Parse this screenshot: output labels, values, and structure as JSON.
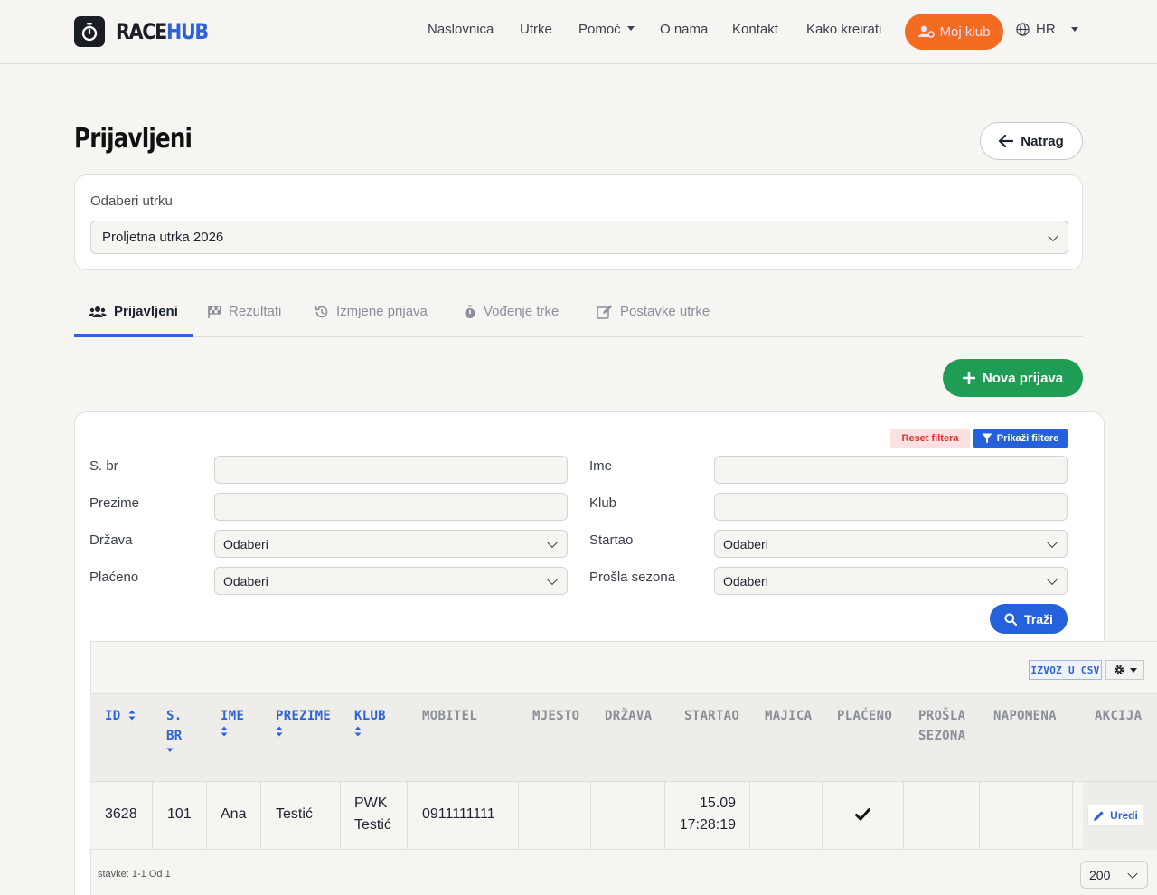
{
  "brand": {
    "part1": "RACE",
    "part2": "HUB",
    "logo_icon": "stopwatch-icon"
  },
  "nav": {
    "items": [
      "Naslovnica",
      "Utrke",
      "Pomoć",
      "O nama",
      "Kontakt",
      "Kako kreirati"
    ],
    "club_button": "Moj klub",
    "language": "HR"
  },
  "page": {
    "title": "Prijavljeni",
    "back_label": "Natrag"
  },
  "race_select": {
    "label": "Odaberi utrku",
    "value": "Proljetna utrka 2026"
  },
  "tabs": [
    "Prijavljeni",
    "Rezultati",
    "Izmjene prijava",
    "Vođenje trke",
    "Postavke utrke"
  ],
  "new_entry_label": "Nova prijava",
  "filters": {
    "reset_label": "Reset filtera",
    "show_label": "Prikaži filtere",
    "fields": [
      {
        "label": "S. br",
        "value": ""
      },
      {
        "label": "Ime",
        "value": ""
      },
      {
        "label": "Prezime",
        "value": ""
      },
      {
        "label": "Klub",
        "value": ""
      },
      {
        "label": "Država",
        "value": "Odaberi"
      },
      {
        "label": "Startao",
        "value": "Odaberi"
      },
      {
        "label": "Plaćeno",
        "value": "Odaberi"
      },
      {
        "label": "Prošla sezona",
        "value": "Odaberi"
      }
    ],
    "search_label": "Traži"
  },
  "table": {
    "csv_label": "IZVOZ U CSV",
    "columns": [
      {
        "lines": [
          "ID"
        ]
      },
      {
        "lines": [
          "S.",
          "BR"
        ]
      },
      {
        "lines": [
          "IME"
        ]
      },
      {
        "lines": [
          "PREZIME"
        ]
      },
      {
        "lines": [
          "KLUB"
        ]
      },
      {
        "lines": [
          "MOBITEL"
        ]
      },
      {
        "lines": [
          "MJESTO"
        ]
      },
      {
        "lines": [
          "DRŽAVA"
        ]
      },
      {
        "lines": [
          "STARTAO"
        ]
      },
      {
        "lines": [
          "MAJICA"
        ]
      },
      {
        "lines": [
          "PLAĆENO"
        ]
      },
      {
        "lines": [
          "PROŠLA",
          "SEZONA"
        ]
      },
      {
        "lines": [
          "NAPOMENA"
        ]
      },
      {
        "lines": [
          "AKCIJA"
        ]
      }
    ],
    "rows": [
      {
        "id": "3628",
        "s_br": "101",
        "ime": "Ana",
        "prezime": "Testić",
        "klub": [
          "PWK",
          "Testić"
        ],
        "mobitel": "0911111111",
        "mjesto": "",
        "drzava": "",
        "startao": [
          "15.09",
          "17:28:19"
        ],
        "majica": "",
        "placeno": true,
        "prosla_sezona": "",
        "napomena": "",
        "action_label": "Uredi"
      }
    ],
    "pagination_text": "stavke: 1-1 Od 1",
    "per_page": "200"
  },
  "colors": {
    "accent_blue": "#2c63d9",
    "orange": "#f26b21",
    "green": "#1f9d55",
    "danger": "#d6322b"
  }
}
